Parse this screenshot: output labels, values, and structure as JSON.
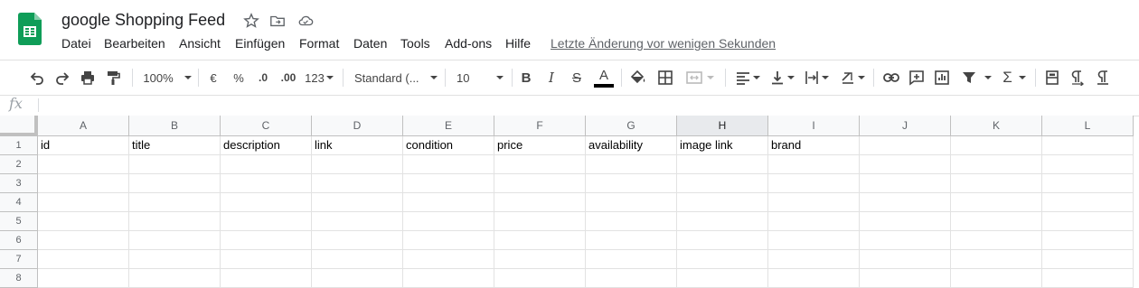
{
  "app": {
    "title": "google Shopping Feed",
    "last_edit": "Letzte Änderung vor wenigen Sekunden",
    "accent": "#0f9d58"
  },
  "menu": [
    "Datei",
    "Bearbeiten",
    "Ansicht",
    "Einfügen",
    "Format",
    "Daten",
    "Tools",
    "Add-ons",
    "Hilfe"
  ],
  "toolbar": {
    "zoom": "100%",
    "currency": "€",
    "percent": "%",
    "dec_less": ".0",
    "dec_more": ".00",
    "more_formats": "123",
    "font": "Standard (...",
    "font_size": "10",
    "bold": "B",
    "italic": "I",
    "strike": "S",
    "text_color": "A",
    "sigma": "Σ"
  },
  "formula_bar": {
    "fx": "fx",
    "value": ""
  },
  "sheet": {
    "columns": [
      "A",
      "B",
      "C",
      "D",
      "E",
      "F",
      "G",
      "H",
      "I",
      "J",
      "K",
      "L"
    ],
    "rows": [
      "1",
      "2",
      "3",
      "4",
      "5",
      "6",
      "7",
      "8"
    ],
    "selected_column": "H",
    "row1": [
      "id",
      "title",
      "description",
      "link",
      "condition",
      "price",
      "availability",
      "image link",
      "brand",
      "",
      "",
      ""
    ]
  }
}
